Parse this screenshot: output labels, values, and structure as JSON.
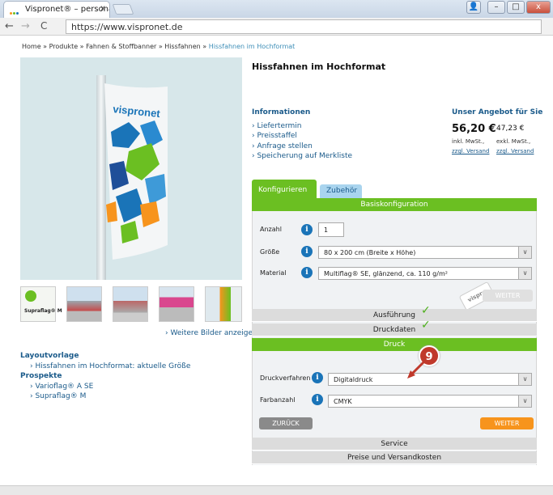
{
  "browser": {
    "tab_title": "Vispronet® – personalisi",
    "tab_close": "x",
    "url": "https://www.vispronet.de",
    "back": "←",
    "forward": "→",
    "reload": "C",
    "win_user": "👤",
    "win_min": "–",
    "win_max": "□",
    "win_close": "x"
  },
  "breadcrumb": {
    "path": "Home » Produkte » Fahnen & Stoffbanner » Hissfahnen » ",
    "current": "Hissfahnen im Hochformat"
  },
  "product": {
    "title": "Hissfahnen im Hochformat",
    "brand_on_flag": "vispronet",
    "thumb1_label": "Supraflag® M",
    "more_images": "› Weitere Bilder anzeigen"
  },
  "left": {
    "layout_heading": "Layoutvorlage",
    "layout_link": "› Hissfahnen im Hochformat: aktuelle Größe",
    "prospekte_heading": "Prospekte",
    "prospekt1": "› Varioflag® A SE",
    "prospekt2": "› Supraflag® M"
  },
  "info": {
    "heading": "Informationen",
    "links": [
      "› Liefertermin",
      "› Preisstaffel",
      "› Anfrage stellen",
      "› Speicherung auf Merkliste"
    ]
  },
  "offer": {
    "heading": "Unser Angebot für Sie",
    "price_gross": "56,20 €",
    "gross_note": "inkl. MwSt.,",
    "gross_shipping": "zzgl. Versand",
    "price_net": "47,23 €",
    "net_note": "exkl. MwSt.,",
    "net_shipping": "zzgl. Versand"
  },
  "config": {
    "tab_active": "Konfigurieren",
    "tab_other": "Zubehör",
    "basis_header": "Basiskonfiguration",
    "anzahl_label": "Anzahl",
    "anzahl_value": "1",
    "groesse_label": "Größe",
    "groesse_value": "80 x 200 cm (Breite x Höhe)",
    "material_label": "Material",
    "material_value": "Multiflag® SE, glänzend, ca. 110 g/m²",
    "weiter_disabled": "WEITER",
    "stamp_text": "vispro",
    "ausfuehrung": "Ausführung",
    "druckdaten": "Druckdaten",
    "druck_header": "Druck",
    "druckverfahren_label": "Druckverfahren",
    "druckverfahren_value": "Digitaldruck",
    "farbanzahl_label": "Farbanzahl",
    "farbanzahl_value": "CMYK",
    "zurueck": "ZURÜCK",
    "weiter": "WEITER",
    "service": "Service",
    "preise": "Preise und Versandkosten",
    "step_badge": "9",
    "check": "✓",
    "info_icon": "i",
    "dropdown": "∨"
  },
  "colors": {
    "green": "#6bbf22",
    "orange": "#f7941d",
    "blue_link": "#1a5a8a",
    "callout_red": "#c0392b"
  }
}
